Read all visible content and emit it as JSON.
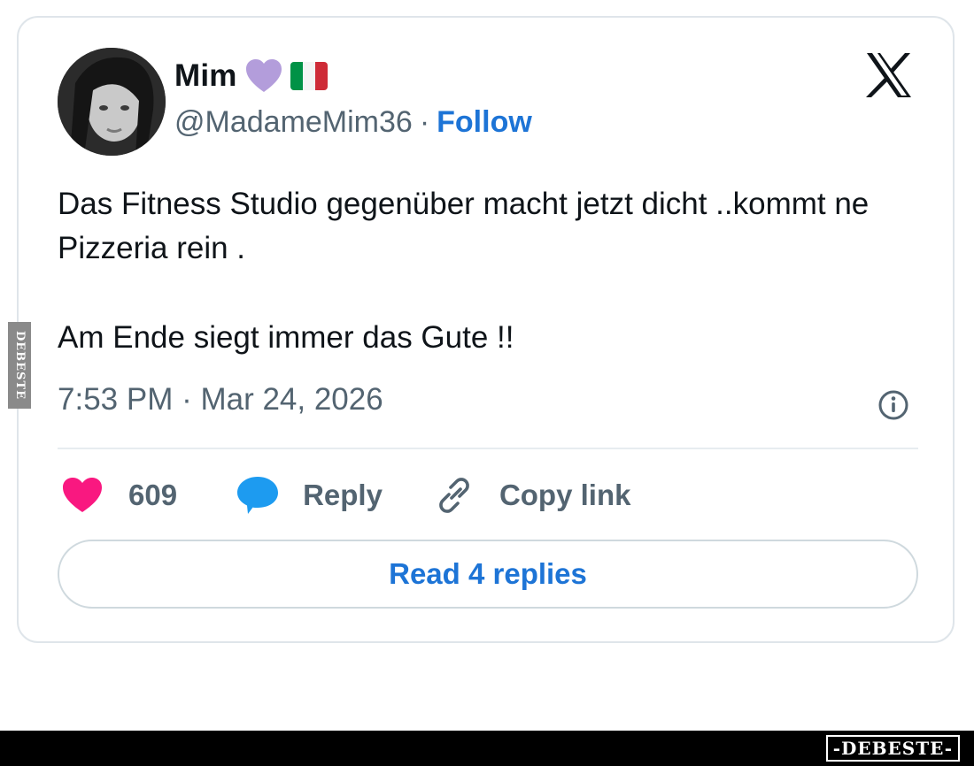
{
  "tweet": {
    "author_name": "Mim",
    "handle": "@MadameMim36",
    "separator": "·",
    "follow_label": "Follow",
    "text_line1": "Das Fitness Studio gegenüber macht jetzt dicht ..kommt ne Pizzeria rein .",
    "text_line2": "Am Ende siegt immer das Gute !!",
    "timestamp": "7:53 PM · Mar 24, 2026"
  },
  "actions": {
    "like_count": "609",
    "reply_label": "Reply",
    "copy_label": "Copy link"
  },
  "read_replies_label": "Read 4 replies",
  "watermark": {
    "side": "DEBESTE",
    "bottom": "-DEBESTE-"
  },
  "icons": {
    "heart_emoji": "purple-heart-icon",
    "flag": "italy-flag-icon",
    "brand": "x-logo-icon",
    "info": "info-icon",
    "like": "heart-icon",
    "reply": "speech-bubble-icon",
    "copy": "link-icon"
  },
  "colors": {
    "accent_blue": "#1d74d6",
    "like_pink": "#f91880",
    "reply_blue": "#1d9bf0",
    "secondary_text": "#536471",
    "purple_heart": "#b39ddb",
    "flag_green": "#009246",
    "flag_white": "#ffffff",
    "flag_red": "#ce2b37"
  }
}
